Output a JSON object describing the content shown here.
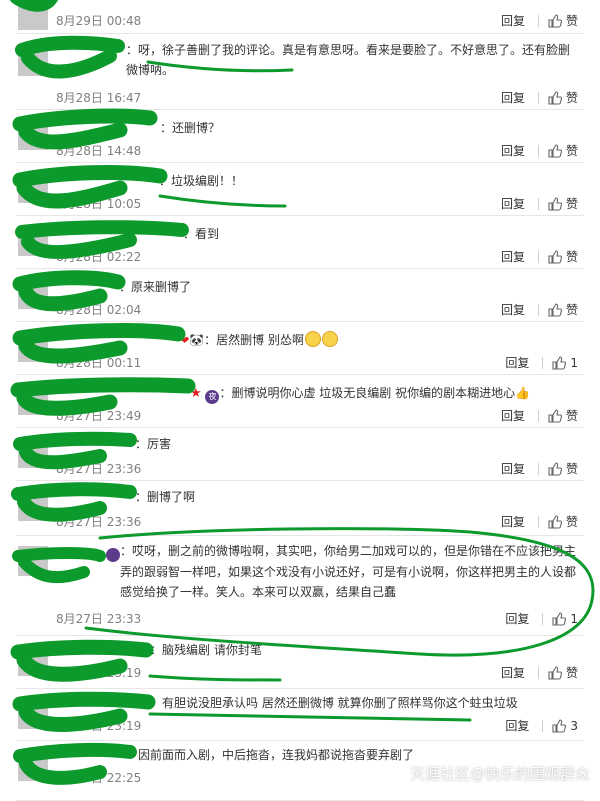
{
  "labels": {
    "reply": "回复",
    "like": "赞"
  },
  "top": {
    "time": "8月29日 00:48",
    "like": "赞"
  },
  "comments": [
    {
      "text": "：呀，徐子善删了我的评论。真是有意思呀。看来是要脸了。不好意思了。还有脸删微博呐。",
      "time": "8月28日 16:47",
      "like": "赞"
    },
    {
      "text": "：还删博？",
      "time": "8月28日 14:48",
      "like": "赞"
    },
    {
      "text": "：垃圾编剧！！",
      "time": "8月28日 10:05",
      "like": "赞"
    },
    {
      "text": "：看到",
      "time": "8月28日 02:22",
      "like": "赞"
    },
    {
      "text": "：原来删博了",
      "time": "8月28日 02:04",
      "like": "赞"
    },
    {
      "text": "：居然删博 别怂啊",
      "time": "8月28日 00:11",
      "like": "1"
    },
    {
      "text": "：删博说明你心虚 垃圾无良编剧 祝你编的剧本糊进地心",
      "time": "8月27日 23:49",
      "like": "赞"
    },
    {
      "text": "：厉害",
      "time": "8月27日 23:36",
      "like": "赞"
    },
    {
      "text": "：删博了啊",
      "time": "8月27日 23:36",
      "like": "赞"
    },
    {
      "text": "：哎呀，删之前的微博啦啊，其实吧，你给男二加戏可以的，但是你错在不应该把男主弄的跟弱智一样吧，如果这个戏没有小说还好，可是有小说啊，你这样把男主的人设都感觉给换了一样。笑人。本来可以双赢，结果自己蠢",
      "time": "8月27日 23:33",
      "like": "1"
    },
    {
      "text": "：脑残编剧 请你封笔",
      "time": "8月27日 23:19",
      "like": "赞"
    },
    {
      "text": "：有胆说没胆承认吗 居然还删微博 就算你删了照样骂你这个蛀虫垃圾",
      "time": "8月27日 23:19",
      "like": "3"
    },
    {
      "text": "因前面而入剧，中后拖沓，连我妈都说拖沓要弃剧了",
      "time": "8月27日 22:25",
      "like": ""
    }
  ],
  "watermark": "天涯社区@快乐的围观群众"
}
